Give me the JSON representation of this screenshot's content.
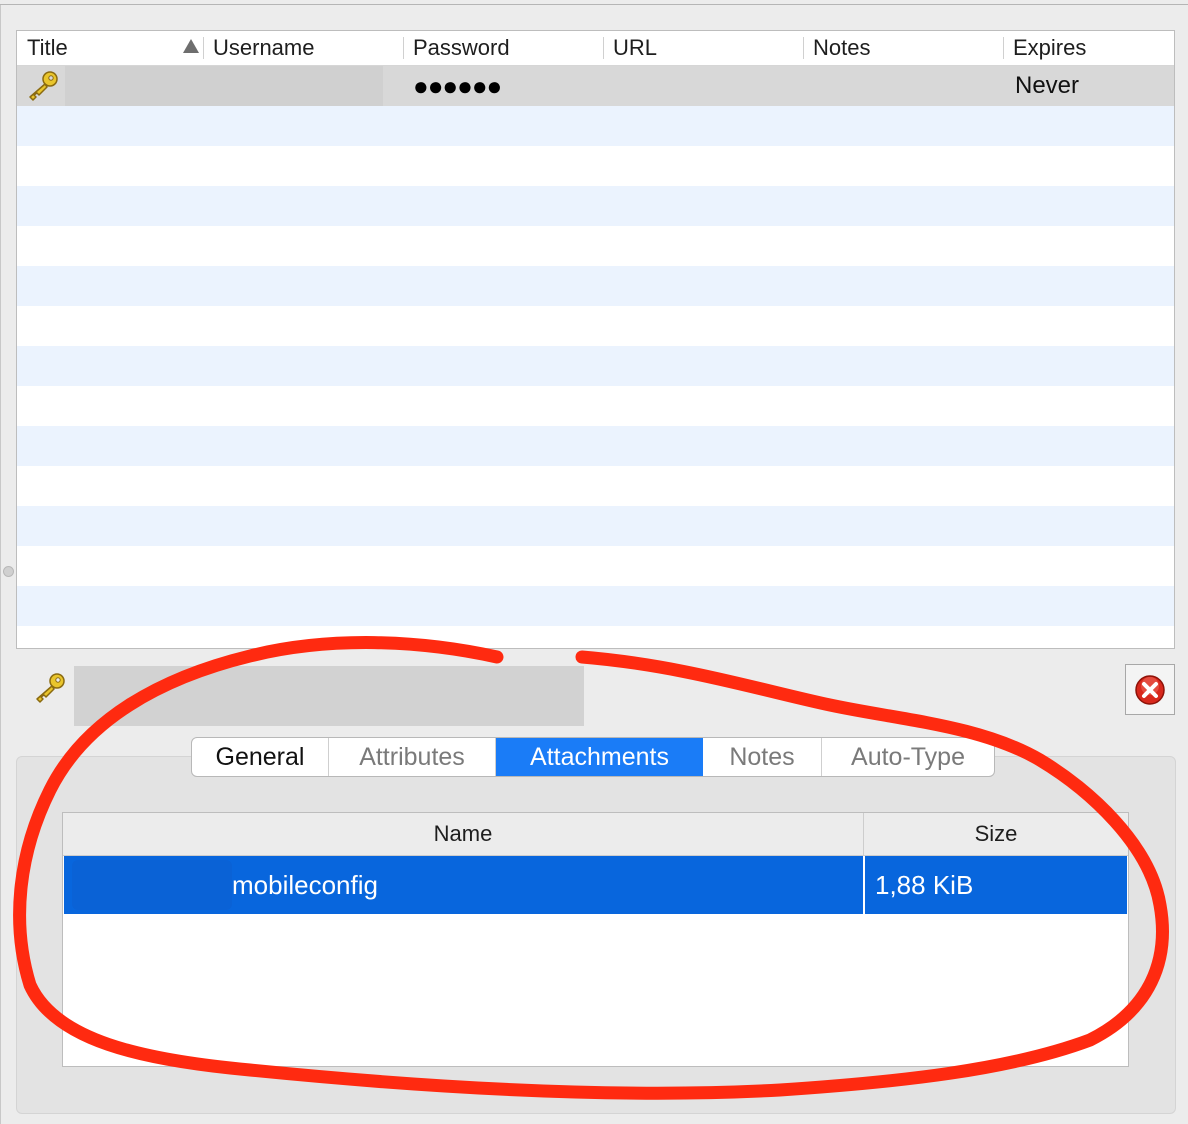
{
  "entry_table": {
    "columns": [
      {
        "label": "Title"
      },
      {
        "label": "Username"
      },
      {
        "label": "Password"
      },
      {
        "label": "URL"
      },
      {
        "label": "Notes"
      },
      {
        "label": "Expires"
      }
    ],
    "sort_column": "Title",
    "rows": [
      {
        "title": "",
        "username": "",
        "password": "●●●●●●",
        "url": "",
        "notes": "",
        "expires": "Never"
      }
    ]
  },
  "detail": {
    "title": "",
    "tabs": [
      {
        "label": "General"
      },
      {
        "label": "Attributes"
      },
      {
        "label": "Attachments"
      },
      {
        "label": "Notes"
      },
      {
        "label": "Auto-Type"
      }
    ],
    "active_tab": "Attachments",
    "attachments": {
      "headers": {
        "name": "Name",
        "size": "Size"
      },
      "rows": [
        {
          "name": "mobileconfig",
          "size": "1,88 KiB"
        }
      ]
    }
  },
  "icons": {
    "entry": "key-icon",
    "close": "close-icon",
    "sort": "sort-ascending-icon"
  },
  "colors": {
    "selection_blue": "#0866dd",
    "active_tab": "#1a7cf7",
    "stripe": "#ebf3fe",
    "annotation": "#ff2a10"
  }
}
